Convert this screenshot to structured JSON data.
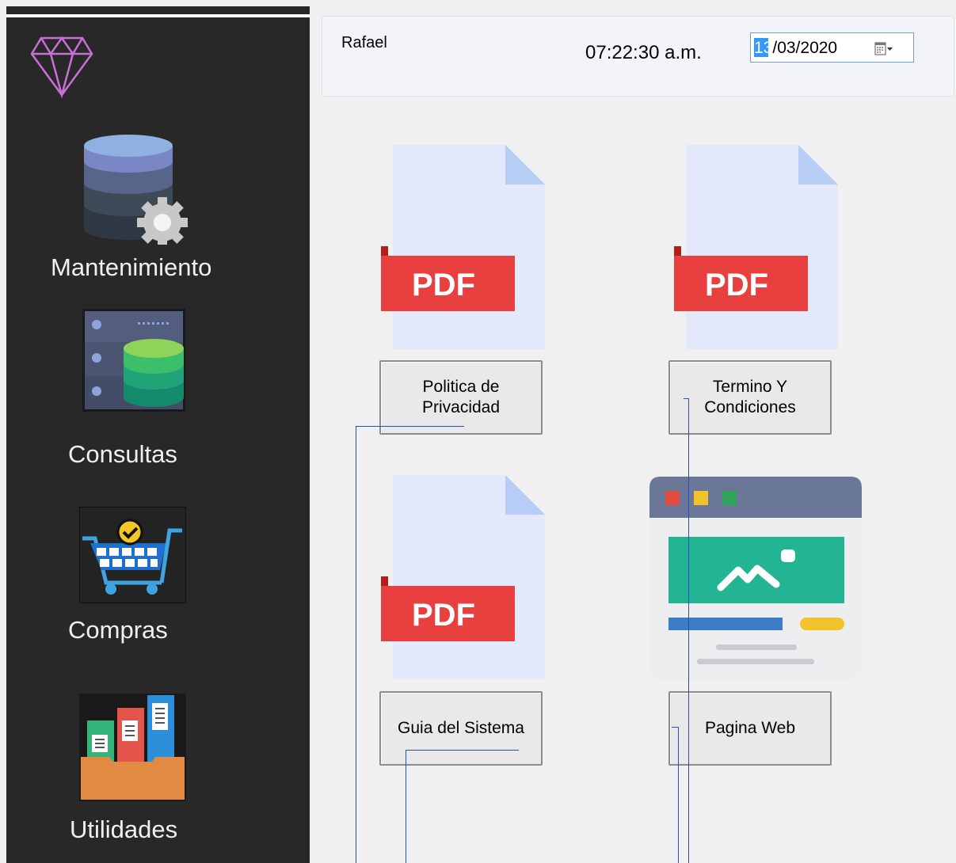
{
  "sidebar": {
    "logo": "diamond-icon",
    "items": [
      {
        "label": "Mantenimiento",
        "icon": "database-gear-icon"
      },
      {
        "label": "Consultas",
        "icon": "server-database-icon"
      },
      {
        "label": "Compras",
        "icon": "shopping-cart-icon"
      },
      {
        "label": "Utilidades",
        "icon": "folder-documents-icon"
      }
    ]
  },
  "header": {
    "user": "Rafael",
    "time": "07:22:30 a.m.",
    "date_day": "13",
    "date_rest": "/03/2020"
  },
  "main": {
    "cards": [
      {
        "label": "Politica de\nPrivacidad",
        "icon": "pdf-file-icon"
      },
      {
        "label": "Termino Y\nCondiciones",
        "icon": "pdf-file-icon"
      },
      {
        "label": "Guia del Sistema",
        "icon": "pdf-file-icon"
      },
      {
        "label": "Pagina Web",
        "icon": "web-page-icon"
      }
    ]
  },
  "colors": {
    "sidebar_bg": "#282828",
    "pdf_red": "#e8403e",
    "accent_blue": "#3399ff"
  }
}
